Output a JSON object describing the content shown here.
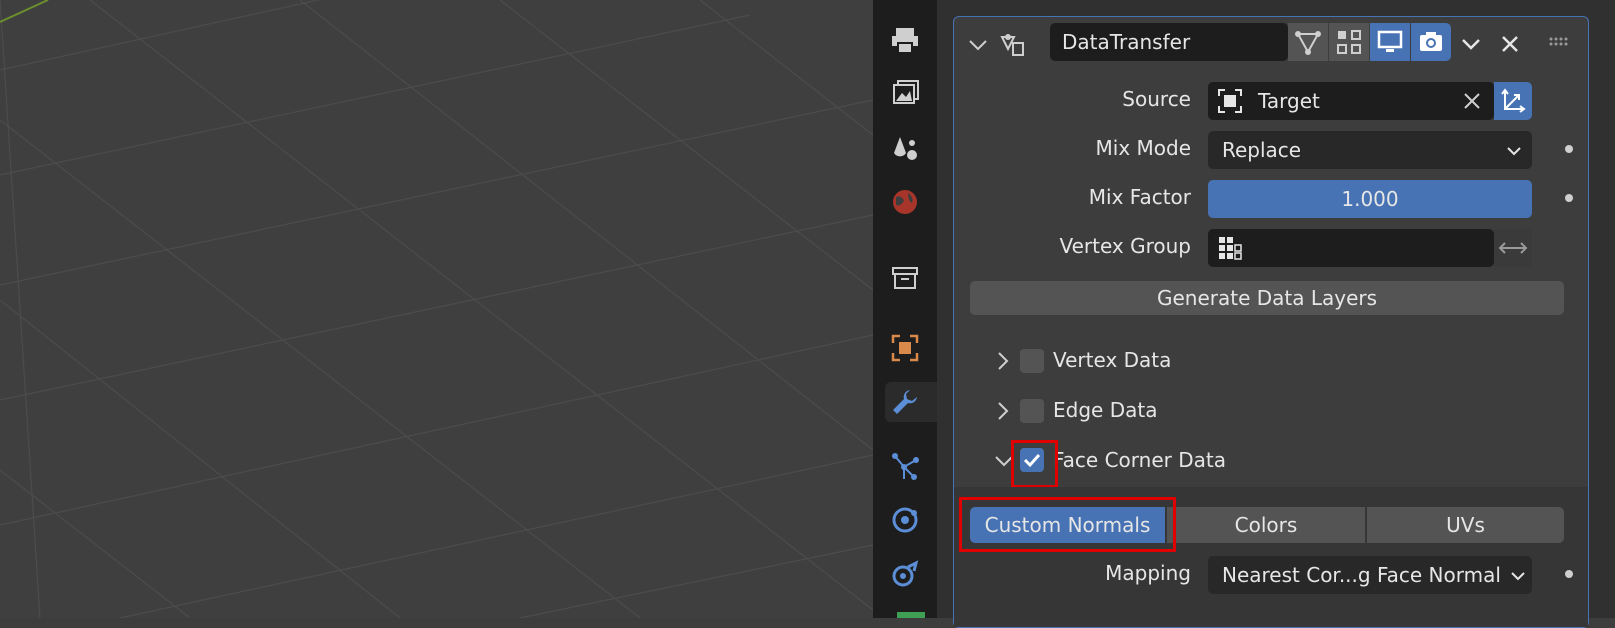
{
  "modifier": {
    "name": "DataTransfer",
    "source": {
      "label": "Source",
      "value": "Target"
    },
    "mix_mode": {
      "label": "Mix Mode",
      "value": "Replace"
    },
    "mix_factor": {
      "label": "Mix Factor",
      "value": "1.000"
    },
    "vertex_group": {
      "label": "Vertex Group",
      "value": ""
    },
    "generate_button": "Generate Data Layers",
    "sections": {
      "vertex": "Vertex Data",
      "edge": "Edge Data",
      "face_corner": "Face Corner Data"
    },
    "face_corner_checked": true,
    "vertex_checked": false,
    "edge_checked": false,
    "data_types": [
      "Custom Normals",
      "Colors",
      "UVs"
    ],
    "selected_data_type": "Custom Normals",
    "mapping": {
      "label": "Mapping",
      "value": "Nearest Cor...g Face Normal"
    }
  },
  "colors": {
    "accent": "#4772b3",
    "highlight": "#e00000",
    "object_orange": "#d9894a"
  },
  "icons": [
    "print-icon",
    "render-output-icon",
    "view-layer-icon",
    "scene-icon",
    "world-icon",
    "collection-icon",
    "object-icon",
    "wrench-icon",
    "particles-icon",
    "physics-icon",
    "constraints-icon"
  ]
}
